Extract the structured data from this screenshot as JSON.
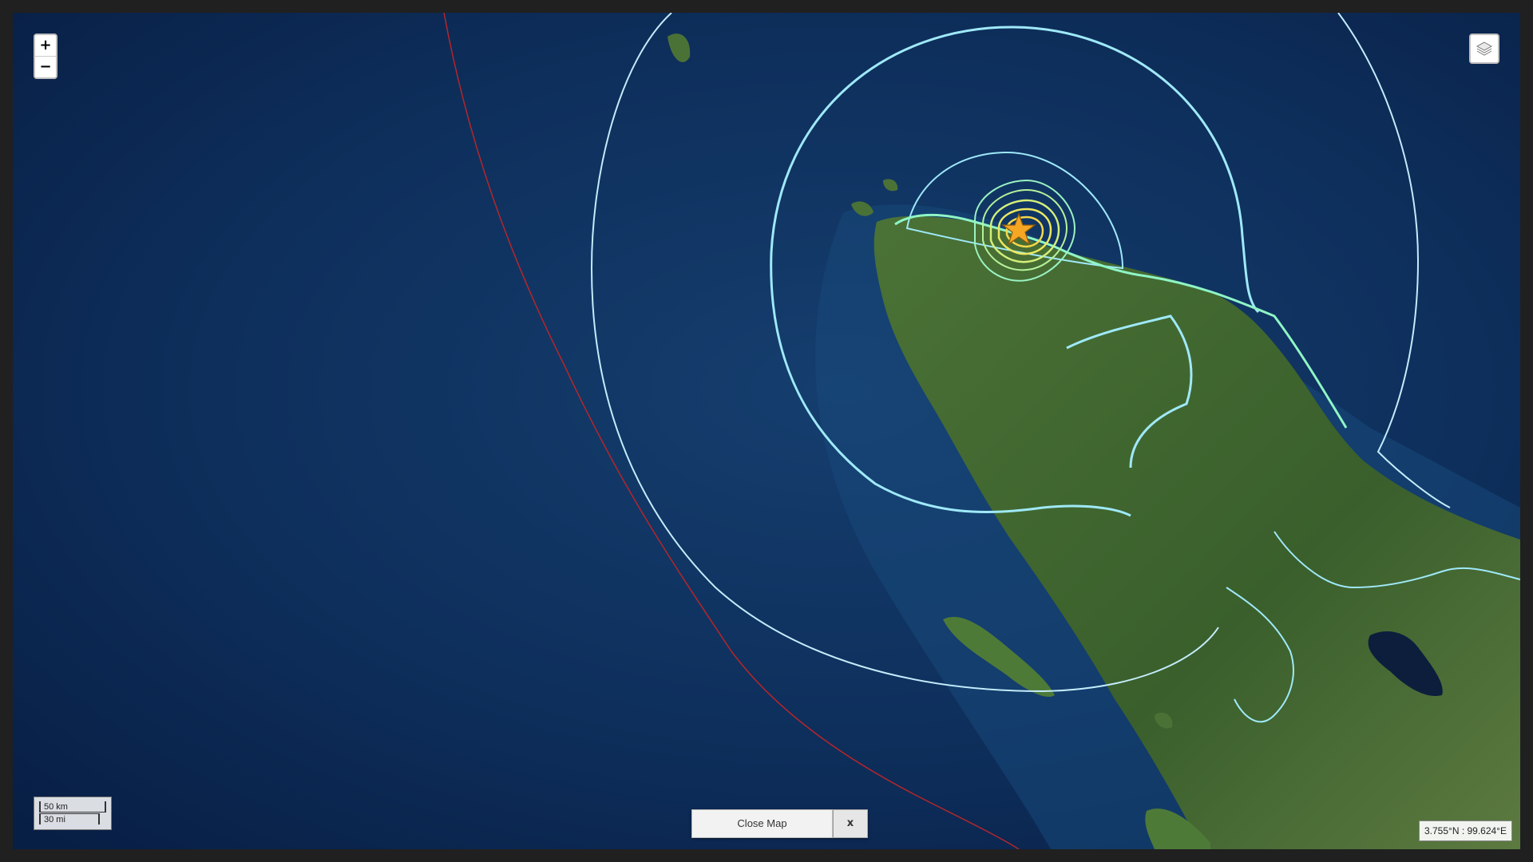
{
  "map": {
    "zoom_in_label": "+",
    "zoom_out_label": "−",
    "scale": {
      "km_label": "50 km",
      "mi_label": "30 mi"
    },
    "coordinates": "3.755°N : 99.624°E",
    "layers_icon": "layers-icon",
    "epicenter_icon": "star-icon",
    "colors": {
      "ocean": "#0b2a55",
      "land": "#3f6630",
      "contour_outer": "#bfe9f7",
      "contour_mid": "#8fe6e6",
      "contour_inner": "#8ff5c5",
      "contour_core": "#f5e65a",
      "plate_boundary": "#b5262a",
      "epicenter": "#f5a623"
    }
  },
  "footer": {
    "close_map_label": "Close Map",
    "close_x_label": "x"
  }
}
